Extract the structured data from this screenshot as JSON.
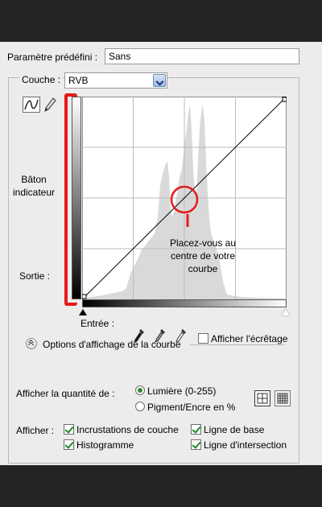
{
  "preset": {
    "label": "Paramètre prédéfini :",
    "value": "Sans"
  },
  "channel": {
    "label": "Couche :",
    "value": "RVB"
  },
  "tools": {
    "curve_icon": "curve-tool-icon",
    "pencil_icon": "pencil-tool-icon"
  },
  "annotations": {
    "baton": "Bâton indicateur",
    "callout_line1": "Placez-vous au",
    "callout_line2": "centre de votre",
    "callout_line3": "courbe",
    "accent": "#e41a1a"
  },
  "axes": {
    "output_label": "Sortie :",
    "input_label": "Entrée :"
  },
  "clipping": {
    "label": "Afficher l'écrêtage",
    "checked": false
  },
  "display_options": {
    "title": "Options d'affichage de la courbe"
  },
  "amount": {
    "label": "Afficher la quantité de :",
    "light": "Lumière (0-255)",
    "pigment": "Pigment/Encre en %",
    "selected": "light"
  },
  "show": {
    "label": "Afficher :",
    "overlays": "Incrustations de couche",
    "baseline": "Ligne de base",
    "histogram": "Histogramme",
    "intersection": "Ligne d'intersection"
  }
}
